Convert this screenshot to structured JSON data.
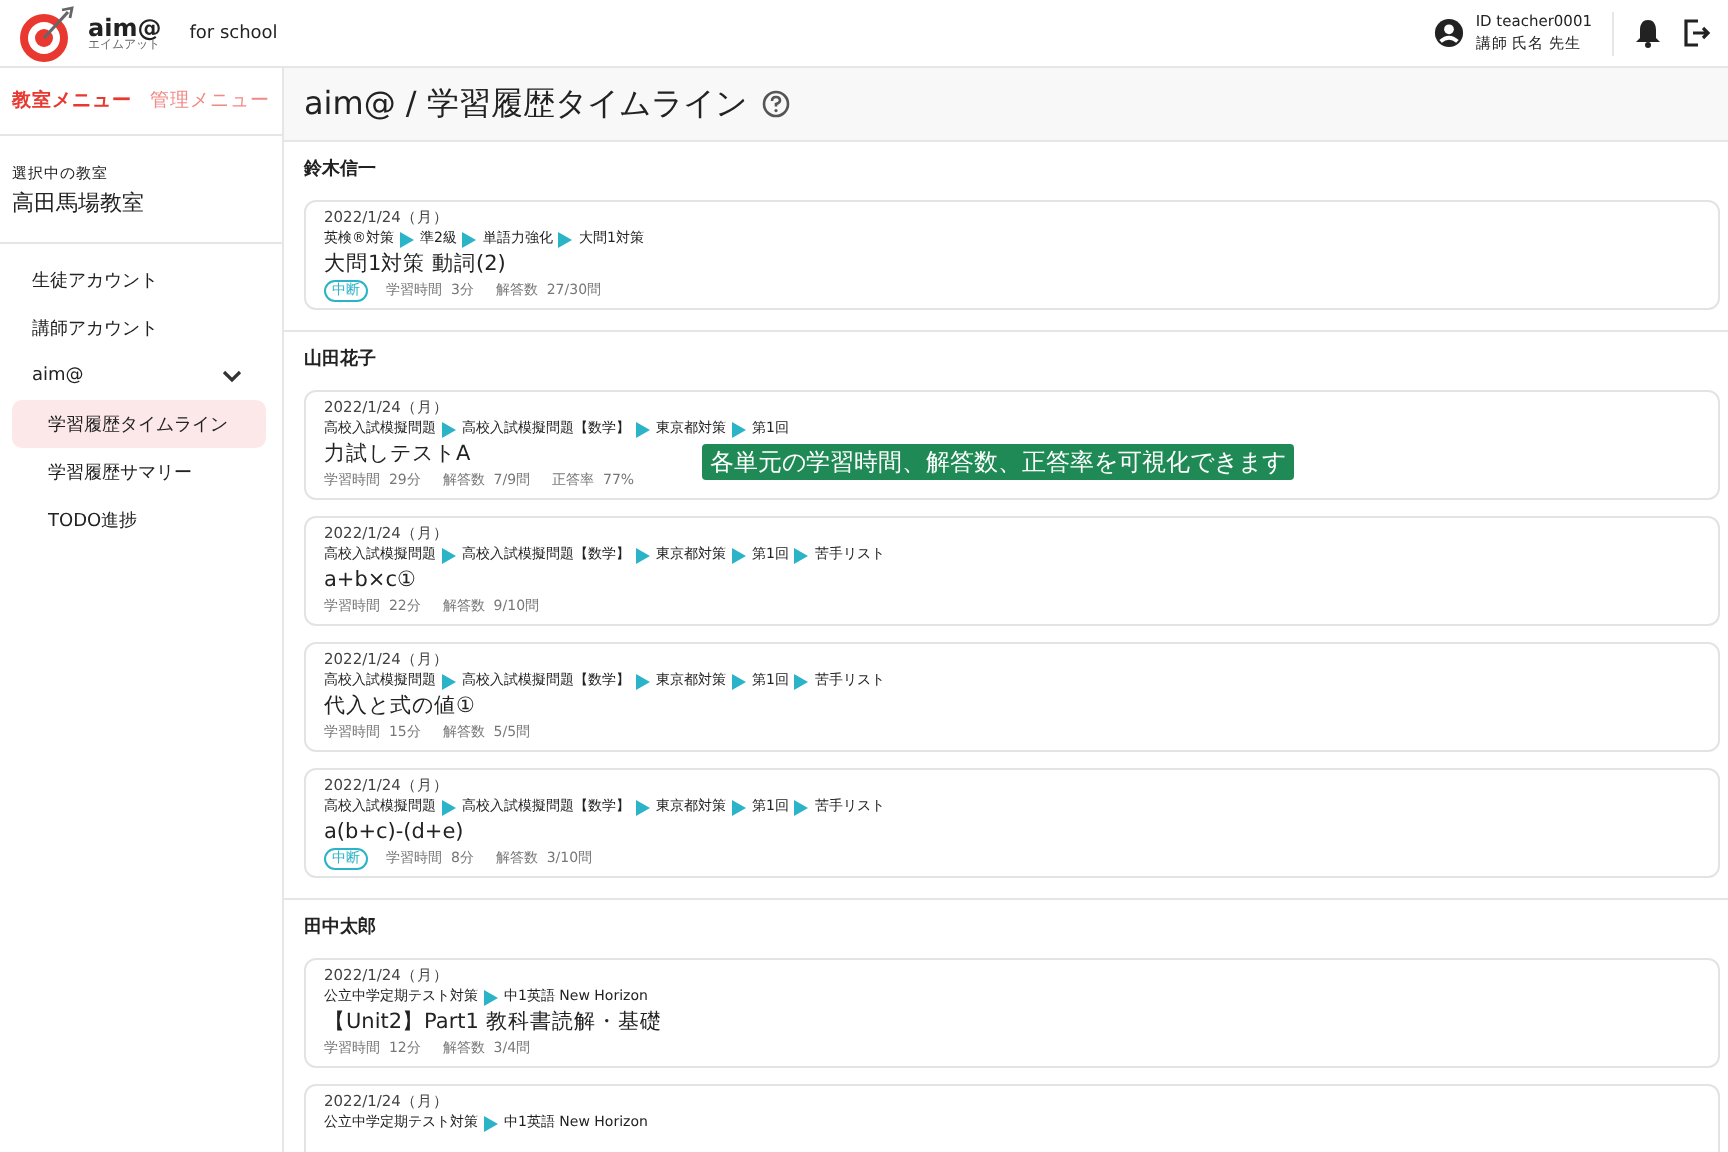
{
  "header": {
    "logo_text": "aim@",
    "logo_sub": "エイムアット",
    "product": "for school",
    "user_id": "ID teacher0001",
    "user_name": "講師 氏名 先生"
  },
  "sidebar": {
    "tabs": [
      {
        "label": "教室メニュー",
        "selected": true
      },
      {
        "label": "管理メニュー",
        "selected": false
      }
    ],
    "classroom_label": "選択中の教室",
    "classroom": "高田馬場教室",
    "items": [
      {
        "label": "生徒アカウント",
        "selected": false
      },
      {
        "label": "講師アカウント",
        "selected": false
      },
      {
        "label": "aim@",
        "selected": false,
        "expanded": true,
        "children": [
          {
            "label": "学習履歴タイムライン",
            "selected": true
          },
          {
            "label": "学習履歴サマリー",
            "selected": false
          },
          {
            "label": "TODO進捗",
            "selected": false
          }
        ]
      }
    ]
  },
  "page_title": "aim@ / 学習履歴タイムライン",
  "students": [
    {
      "name": "鈴木信一",
      "entries": [
        {
          "date": "2022/1/24（月）",
          "path": [
            "英検®対策",
            "準2級",
            "単語力強化",
            "大問1対策"
          ],
          "title": "大問1対策 動詞(2)",
          "status": "中断",
          "stats": [
            [
              "学習時間",
              "3分"
            ],
            [
              "解答数",
              "27/30問"
            ]
          ]
        }
      ]
    },
    {
      "name": "山田花子",
      "entries": [
        {
          "date": "2022/1/24（月）",
          "path": [
            "高校入試模擬問題",
            "高校入試模擬問題【数学】",
            "東京都対策",
            "第1回"
          ],
          "title": "力試しテストA",
          "stats": [
            [
              "学習時間",
              "29分"
            ],
            [
              "解答数",
              "7/9問"
            ],
            [
              "正答率",
              "77%"
            ]
          ]
        },
        {
          "date": "2022/1/24（月）",
          "path": [
            "高校入試模擬問題",
            "高校入試模擬問題【数学】",
            "東京都対策",
            "第1回",
            "苦手リスト"
          ],
          "title": "a+b×c①",
          "stats": [
            [
              "学習時間",
              "22分"
            ],
            [
              "解答数",
              "9/10問"
            ]
          ]
        },
        {
          "date": "2022/1/24（月）",
          "path": [
            "高校入試模擬問題",
            "高校入試模擬問題【数学】",
            "東京都対策",
            "第1回",
            "苦手リスト"
          ],
          "title": "代入と式の値①",
          "stats": [
            [
              "学習時間",
              "15分"
            ],
            [
              "解答数",
              "5/5問"
            ]
          ]
        },
        {
          "date": "2022/1/24（月）",
          "path": [
            "高校入試模擬問題",
            "高校入試模擬問題【数学】",
            "東京都対策",
            "第1回",
            "苦手リスト"
          ],
          "title": "a(b+c)-(d+e)",
          "status": "中断",
          "stats": [
            [
              "学習時間",
              "8分"
            ],
            [
              "解答数",
              "3/10問"
            ]
          ]
        }
      ]
    },
    {
      "name": "田中太郎",
      "entries": [
        {
          "date": "2022/1/24（月）",
          "path": [
            "公立中学定期テスト対策",
            "中1英語 New Horizon"
          ],
          "title": "【Unit2】Part1 教科書読解・基礎",
          "stats": [
            [
              "学習時間",
              "12分"
            ],
            [
              "解答数",
              "3/4問"
            ]
          ]
        },
        {
          "date": "2022/1/24（月）",
          "path": [
            "公立中学定期テスト対策",
            "中1英語 New Horizon"
          ]
        }
      ]
    }
  ],
  "callout": "各単元の学習時間、解答数、正答率を可視化できます"
}
